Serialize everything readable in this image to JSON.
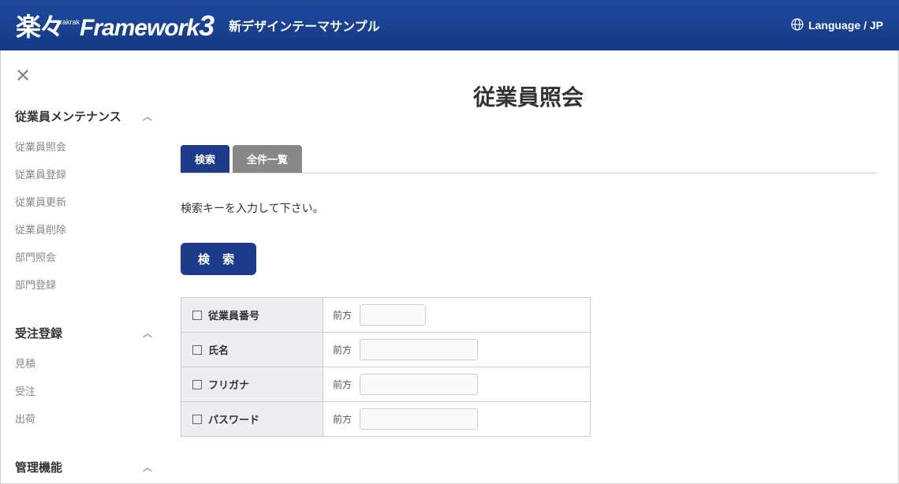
{
  "header": {
    "logo_jp": "楽々",
    "logo_small": "rakrak",
    "logo_fw": "Framework",
    "logo_3": "3",
    "subtitle": "新デザインテーマサンプル",
    "language_label": "Language / JP"
  },
  "sidebar": {
    "groups": [
      {
        "title": "従業員メンテナンス",
        "items": [
          "従業員照会",
          "従業員登録",
          "従業員更新",
          "従業員削除",
          "部門照会",
          "部門登録"
        ]
      },
      {
        "title": "受注登録",
        "items": [
          "見積",
          "受注",
          "出荷"
        ]
      },
      {
        "title": "管理機能",
        "items": []
      }
    ]
  },
  "main": {
    "page_title": "従業員照会",
    "tabs": {
      "search": "検索",
      "all": "全件一覧"
    },
    "instruction": "検索キーを入力して下さい。",
    "search_button": "検 索",
    "match_prefix": "前方",
    "fields": [
      {
        "label": "従業員番号",
        "input_width": "short"
      },
      {
        "label": "氏名",
        "input_width": "med"
      },
      {
        "label": "フリガナ",
        "input_width": "med"
      },
      {
        "label": "パスワード",
        "input_width": "med"
      }
    ]
  }
}
